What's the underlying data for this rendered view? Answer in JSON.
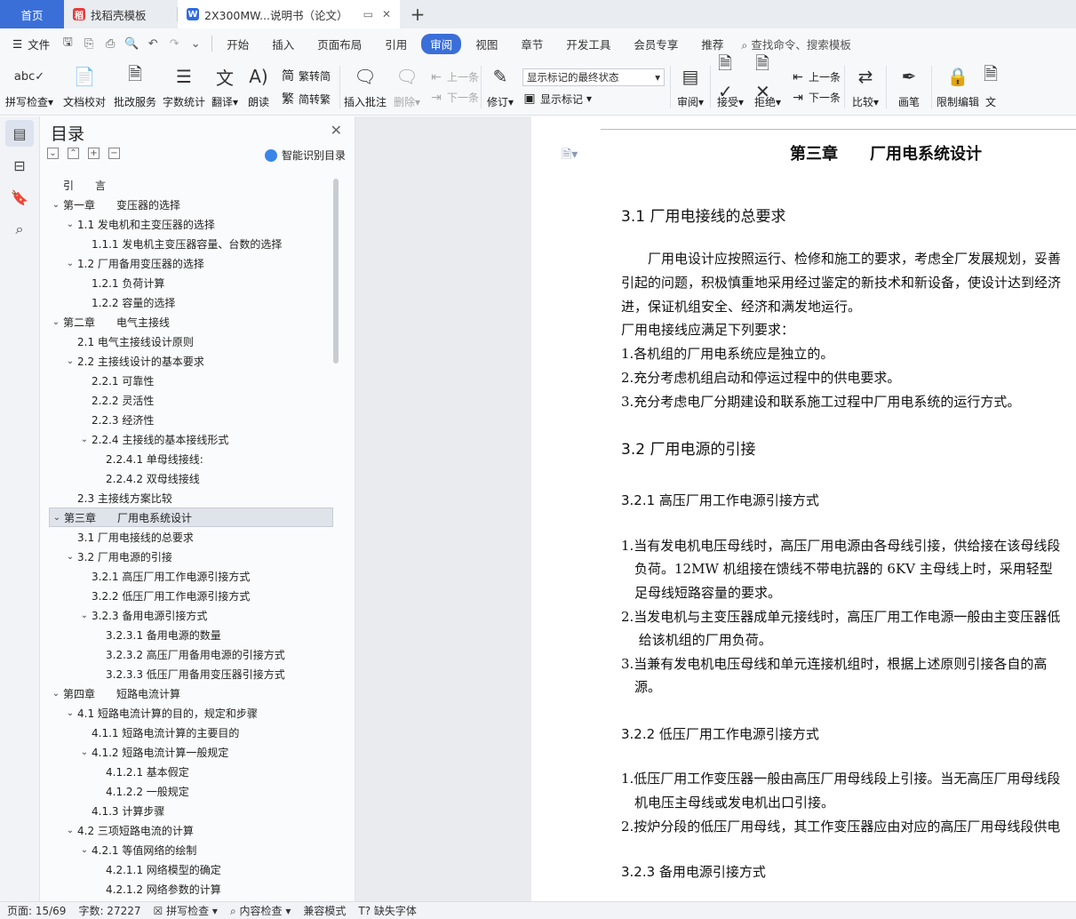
{
  "tabs": {
    "home": "首页",
    "template": "找稻壳模板",
    "doc": "2X300MW...说明书（论文）",
    "add": "+"
  },
  "menu": {
    "file": "文件",
    "items": [
      "开始",
      "插入",
      "页面布局",
      "引用",
      "审阅",
      "视图",
      "章节",
      "开发工具",
      "会员专享",
      "推荐"
    ],
    "active_index": 4,
    "search": "查找命令、搜索模板"
  },
  "ribbon": {
    "spell": "拼写检查",
    "proof": "文档校对",
    "annotate_service": "批改服务",
    "wordcount": "字数统计",
    "translate": "翻译",
    "read": "朗读",
    "t2s": "繁转简",
    "s2t": "简转繁",
    "insert_comment": "插入批注",
    "delete": "删除",
    "prev": "上一条",
    "next": "下一条",
    "revise": "修订",
    "markup_select": "显示标记的最终状态",
    "show_markup": "显示标记",
    "review": "审阅",
    "accept": "接受",
    "reject": "拒绝",
    "prev2": "上一条",
    "next2": "下一条",
    "compare": "比较",
    "pen": "画笔",
    "restrict": "限制编辑",
    "doc_cut": "文"
  },
  "toc": {
    "title": "目录",
    "smart": "智能识别目录",
    "items": [
      {
        "level": 0,
        "caret": "",
        "text": "引　　言"
      },
      {
        "level": 0,
        "caret": "v",
        "text": "第一章　　变压器的选择"
      },
      {
        "level": 1,
        "caret": "v",
        "text": "1.1 发电机和主变压器的选择"
      },
      {
        "level": 2,
        "caret": "",
        "text": "1.1.1 发电机主变压器容量、台数的选择"
      },
      {
        "level": 1,
        "caret": "v",
        "text": "1.2 厂用备用变压器的选择"
      },
      {
        "level": 2,
        "caret": "",
        "text": "1.2.1 负荷计算"
      },
      {
        "level": 2,
        "caret": "",
        "text": "1.2.2 容量的选择"
      },
      {
        "level": 0,
        "caret": "v",
        "text": "第二章　　电气主接线"
      },
      {
        "level": 1,
        "caret": "",
        "text": "2.1 电气主接线设计原则"
      },
      {
        "level": 1,
        "caret": "v",
        "text": "2.2 主接线设计的基本要求"
      },
      {
        "level": 2,
        "caret": "",
        "text": "2.2.1 可靠性"
      },
      {
        "level": 2,
        "caret": "",
        "text": "2.2.2 灵活性"
      },
      {
        "level": 2,
        "caret": "",
        "text": "2.2.3 经济性"
      },
      {
        "level": 2,
        "caret": "v",
        "text": "2.2.4 主接线的基本接线形式"
      },
      {
        "level": 3,
        "caret": "",
        "text": "2.2.4.1 单母线接线:"
      },
      {
        "level": 3,
        "caret": "",
        "text": "2.2.4.2 双母线接线"
      },
      {
        "level": 1,
        "caret": "",
        "text": "2.3 主接线方案比较"
      },
      {
        "level": 0,
        "caret": "v",
        "text": "第三章　　厂用电系统设计",
        "selected": true
      },
      {
        "level": 1,
        "caret": "",
        "text": "3.1 厂用电接线的总要求"
      },
      {
        "level": 1,
        "caret": "v",
        "text": "3.2 厂用电源的引接"
      },
      {
        "level": 2,
        "caret": "",
        "text": "3.2.1 高压厂用工作电源引接方式"
      },
      {
        "level": 2,
        "caret": "",
        "text": "3.2.2 低压厂用工作电源引接方式"
      },
      {
        "level": 2,
        "caret": "v",
        "text": "3.2.3 备用电源引接方式"
      },
      {
        "level": 3,
        "caret": "",
        "text": "3.2.3.1 备用电源的数量"
      },
      {
        "level": 3,
        "caret": "",
        "text": "3.2.3.2 高压厂用备用电源的引接方式"
      },
      {
        "level": 3,
        "caret": "",
        "text": "3.2.3.3 低压厂用备用变压器引接方式"
      },
      {
        "level": 0,
        "caret": "v",
        "text": "第四章　　短路电流计算"
      },
      {
        "level": 1,
        "caret": "v",
        "text": "4.1 短路电流计算的目的，规定和步骤"
      },
      {
        "level": 2,
        "caret": "",
        "text": "4.1.1 短路电流计算的主要目的"
      },
      {
        "level": 2,
        "caret": "v",
        "text": "4.1.2 短路电流计算一般规定"
      },
      {
        "level": 3,
        "caret": "",
        "text": "4.1.2.1 基本假定"
      },
      {
        "level": 3,
        "caret": "",
        "text": "4.1.2.2 一般规定"
      },
      {
        "level": 2,
        "caret": "",
        "text": "4.1.3 计算步骤"
      },
      {
        "level": 1,
        "caret": "v",
        "text": "4.2 三项短路电流的计算"
      },
      {
        "level": 2,
        "caret": "v",
        "text": "4.2.1 等值网络的绘制"
      },
      {
        "level": 3,
        "caret": "",
        "text": "4.2.1.1 网络模型的确定"
      },
      {
        "level": 3,
        "caret": "",
        "text": "4.2.1.2 网络参数的计算"
      }
    ]
  },
  "doc": {
    "chapter": "第三章　　厂用电系统设计",
    "s31": "3.1 厂用电接线的总要求",
    "p1": "　　厂用电设计应按照运行、检修和施工的要求，考虑全厂发展规划，妥善",
    "p2": "引起的问题，积极慎重地采用经过鉴定的新技术和新设备，使设计达到经济",
    "p3": "进，保证机组安全、经济和满发地运行。",
    "p4": "厂用电接线应满足下列要求：",
    "p5": "1.各机组的厂用电系统应是独立的。",
    "p6": "2.充分考虑机组启动和停运过程中的供电要求。",
    "p7": "3.充分考虑电厂分期建设和联系施工过程中厂用电系统的运行方式。",
    "s32": "3.2 厂用电源的引接",
    "s321": "3.2.1 高压厂用工作电源引接方式",
    "q1": "1.当有发电机电压母线时，高压厂用电源由各母线引接，供给接在该母线段",
    "q2": "　负荷。12MW 机组接在馈线不带电抗器的 6KV 主母线上时，采用轻型",
    "q3": "　足母线短路容量的要求。",
    "q4": "2.当发电机与主变压器成单元接线时，高压厂用工作电源一般由主变压器低",
    "q5": "　 给该机组的厂用负荷。",
    "q6": "3.当兼有发电机电压母线和单元连接机组时，根据上述原则引接各自的高",
    "q7": "　源。",
    "s322": "3.2.2 低压厂用工作电源引接方式",
    "r1": "1.低压厂用工作变压器一般由高压厂用母线段上引接。当无高压厂用母线段",
    "r2": "　机电压主母线或发电机出口引接。",
    "r3": "2.按炉分段的低压厂用母线，其工作变压器应由对应的高压厂用母线段供电",
    "s323": "3.2.3 备用电源引接方式"
  },
  "status": {
    "page": "页面: 15/69",
    "words": "字数: 27227",
    "spell": "拼写检查",
    "content": "内容检查",
    "compat": "兼容模式",
    "font": "缺失字体"
  }
}
